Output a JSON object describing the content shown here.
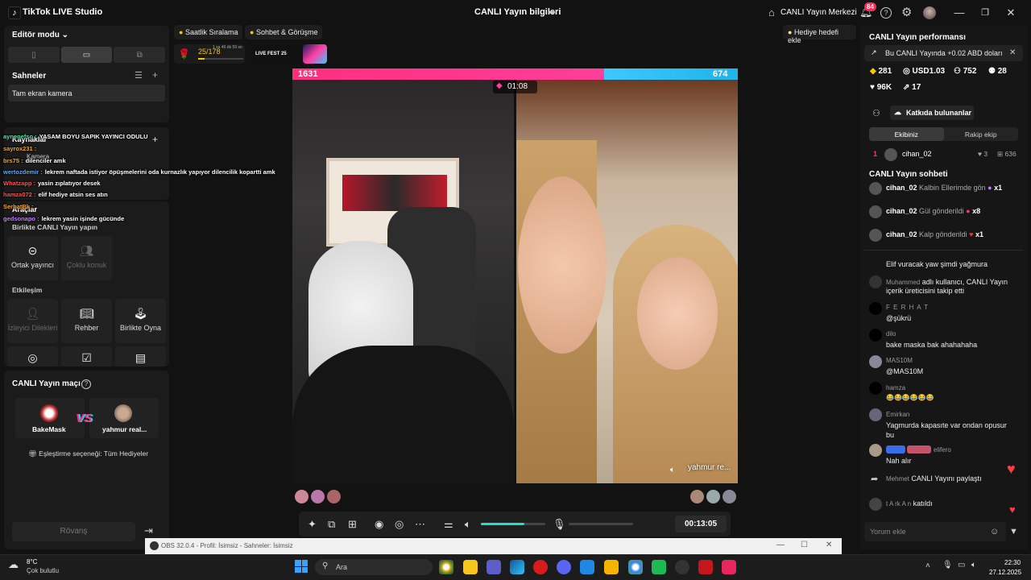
{
  "titlebar": {
    "app_name": "TikTok LIVE Studio",
    "center_title": "CANLI Yayın bilgileri",
    "hub_label": "CANLI Yayın Merkezi",
    "notif_count": "84"
  },
  "left": {
    "editor_mode": "Editör modu",
    "scenes_title": "Sahneler",
    "scene_item": "Tam ekran kamera",
    "sources_title": "Kaynaklar",
    "source_item": "Kamera",
    "tools_title": "Araçlar",
    "collab_title": "Birlikte CANLI Yayın yapın",
    "tiles_collab": [
      "Ortak yayıncı",
      "Çoklu konuk"
    ],
    "interaction_title": "Etkileşim",
    "tiles_interaction": [
      "İzleyici Dilekleri",
      "Rehber",
      "Birlikte Oyna"
    ],
    "match_title": "CANLI Yayın maçı",
    "player_left": "BakeMask",
    "player_right": "yahmur real...",
    "vs": "VS",
    "match_option": "Eşleştirme seçeneği: Tüm Hediyeler",
    "rematch": "Rövanş"
  },
  "overlay_chat": [
    {
      "user": "aynenefso :",
      "text": "YASAM BOYU SAPIK YAYINCI ODULU"
    },
    {
      "user": "sayrox231 :",
      "text": ""
    },
    {
      "user": "brs75 :",
      "text": "dilenciler amk"
    },
    {
      "user": "wertozdemir :",
      "text": "lekrem naftada istiyor öpüşmelerini oda kurnazlık yapıyor dilencilik kopartti amk"
    },
    {
      "user": "Whatzapp :",
      "text": "yasin zıplatıyor desek"
    },
    {
      "user": "hamza072 :",
      "text": "elif hediye atsin ses atın"
    },
    {
      "user": "SerhatBk :",
      "text": ""
    },
    {
      "user": "gedsonapo :",
      "text": "lekrem yasin işinde gücünde"
    }
  ],
  "center": {
    "chip_hourly": "Saatlik Sıralama",
    "chip_chat": "Sohbet & Görüşme",
    "gift_goal": "Hediye hedefi ekle",
    "progress": "25/178",
    "progress_time": "1 sa 46 dk 59 sn",
    "fest": "LIVE FEST 25",
    "score_left": "1631",
    "score_right": "674",
    "battle_timer": "01:08",
    "guest_name": "yahmur re...",
    "stream_time": "00:13:05"
  },
  "right": {
    "perf_title": "CANLI Yayın performansı",
    "earn_notice": "Bu CANLI Yayında +0.02 ABD doları",
    "stats": [
      "281",
      "USD1.03",
      "752",
      "28",
      "96K",
      "17"
    ],
    "contributors": "Katkıda bulunanlar",
    "tab_our": "Ekibiniz",
    "tab_rival": "Rakip ekip",
    "top_rank": "1",
    "top_user": "cihan_02",
    "top_likes": "3",
    "top_gifts": "636",
    "chat_title": "CANLI Yayın sohbeti",
    "gifts": [
      {
        "user": "cihan_02",
        "text": "Kalbin Ellerimde gön",
        "count": "x1"
      },
      {
        "user": "cihan_02",
        "text": "Gül gönderildi",
        "count": "x8"
      },
      {
        "user": "cihan_02",
        "text": "Kalp gönderildi",
        "count": "x1"
      }
    ],
    "messages": [
      {
        "user": "",
        "text": "Elif vuracak yaw şimdi yağmura"
      },
      {
        "user": "Muhammed",
        "text": "adlı kullanıcı, CANLI Yayın içerik üreticisini takip etti"
      },
      {
        "user": "F E R H A T",
        "text": "@şükrü"
      },
      {
        "user": "dilo",
        "text": "bake maska bak ahahahaha"
      },
      {
        "user": "MAS10M",
        "text": "@MAS10M"
      },
      {
        "user": "hamza",
        "text": "😂😂😂😂😂😂"
      },
      {
        "user": "Emirkan",
        "text": "Yagmurda kapasıte var ondan opusur bu"
      },
      {
        "user": "elifero",
        "text": "Nah alır"
      },
      {
        "user": "Mehmet",
        "text": "CANLI Yayını paylaştı"
      },
      {
        "user": "t A rk A n",
        "text": "katıldı"
      }
    ],
    "comment_placeholder": "Yorum ekle"
  },
  "obs_bar": "OBS 32.0.4 - Profil: İsimsiz - Sahneler: İsimsiz",
  "taskbar": {
    "weather_temp": "8°C",
    "weather_desc": "Çok bulutlu",
    "search": "Ara",
    "time": "22:30",
    "date": "27.12.2025"
  }
}
